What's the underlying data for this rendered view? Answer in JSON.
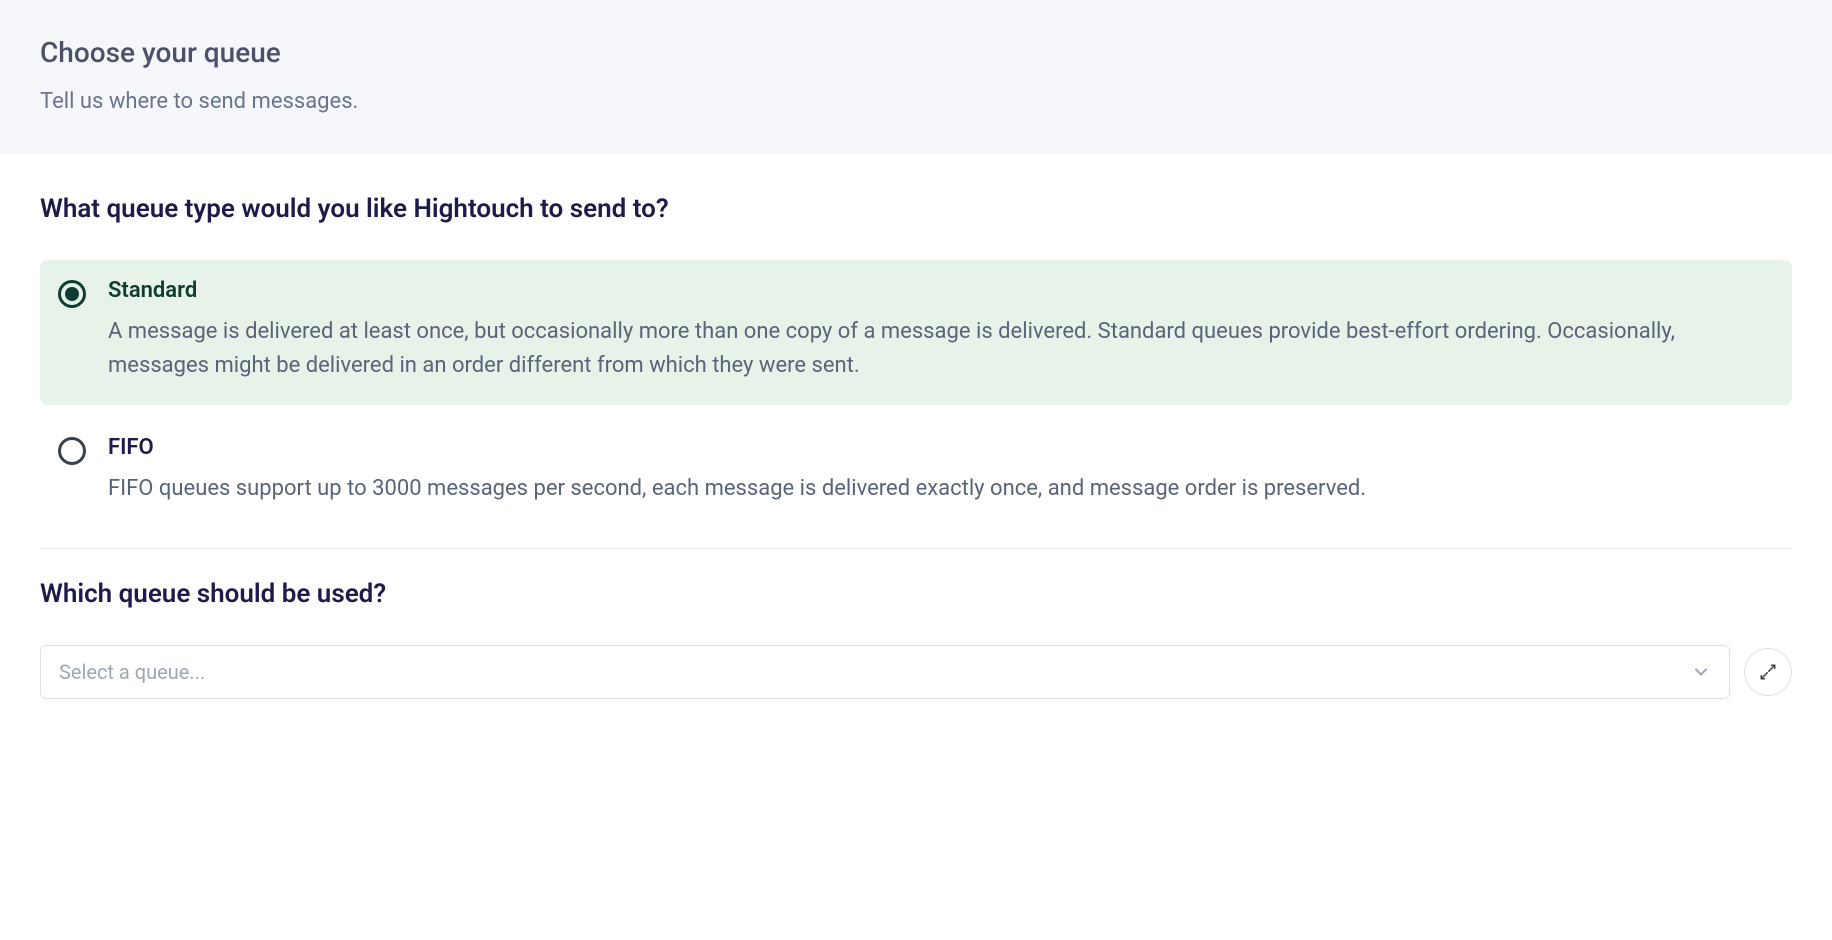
{
  "header": {
    "title": "Choose your queue",
    "subtitle": "Tell us where to send messages."
  },
  "queueType": {
    "question": "What queue type would you like Hightouch to send to?",
    "options": [
      {
        "label": "Standard",
        "description": "A message is delivered at least once, but occasionally more than one copy of a message is delivered. Standard queues provide best-effort ordering. Occasionally, messages might be delivered in an order different from which they were sent.",
        "selected": true
      },
      {
        "label": "FIFO",
        "description": "FIFO queues support up to 3000 messages per second, each message is delivered exactly once, and message order is preserved.",
        "selected": false
      }
    ]
  },
  "queueSelect": {
    "question": "Which queue should be used?",
    "placeholder": "Select a queue..."
  }
}
